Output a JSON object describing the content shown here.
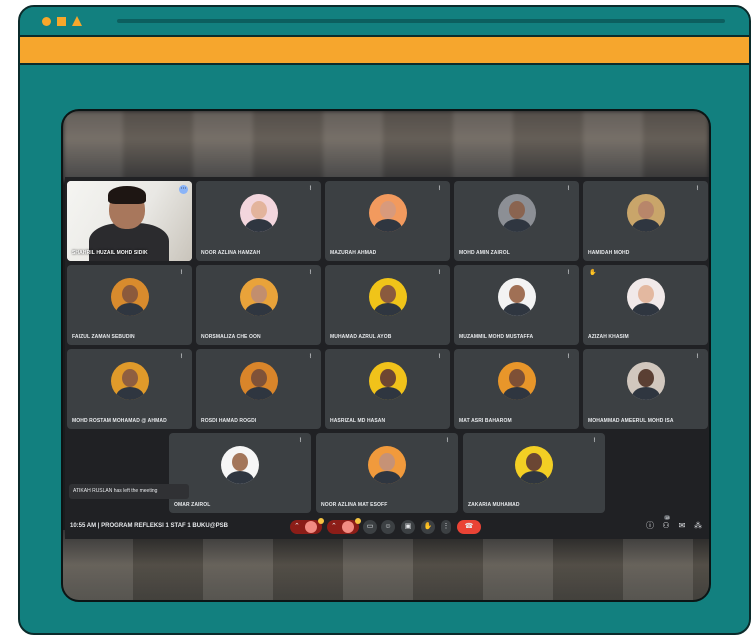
{
  "meeting": {
    "time": "10:55 AM",
    "separator": "|",
    "title": "PROGRAM REFLEKSI 1 STAF 1 BUKU@PSB",
    "toast": "ATIKAH RUSLAN has left the meeting"
  },
  "participants": [
    {
      "name": "SHAHRIL HUZAIL MOHD SIDIK",
      "avatar_color": "#e8e6e0",
      "skin": "#a8775c"
    },
    {
      "name": "NOOR AZLINA HAMZAH",
      "avatar_color": "#f3d6dd",
      "skin": "#e3b49c"
    },
    {
      "name": "MAZURAH AHMAD",
      "avatar_color": "#f29a5e",
      "skin": "#d89a7c"
    },
    {
      "name": "MOHD AMIN ZAIROL",
      "avatar_color": "#8c8f95",
      "skin": "#8a6450"
    },
    {
      "name": "HAMIDAH MOHD",
      "avatar_color": "#c9a56a",
      "skin": "#b8866a"
    },
    {
      "name": "FAIZUL ZAMAN SEBUDIN",
      "avatar_color": "#d88b2d",
      "skin": "#8b5a3c"
    },
    {
      "name": "NORSMALIZA CHE OON",
      "avatar_color": "#e9a33a",
      "skin": "#c28e6e"
    },
    {
      "name": "MUHAMAD AZRUL AYOB",
      "avatar_color": "#f0c419",
      "skin": "#8a5a3e"
    },
    {
      "name": "MUZAMMIL MOHD MUSTAFFA",
      "avatar_color": "#f3f3f3",
      "skin": "#a07055"
    },
    {
      "name": "AZIZAH KHASIM",
      "avatar_color": "#f1e9e9",
      "skin": "#e3b8a0"
    },
    {
      "name": "MOHD ROSTAM MOHAMAD @ AHMAD",
      "avatar_color": "#e09a2a",
      "skin": "#8f5e40"
    },
    {
      "name": "ROSDI HAMAD ROGDI",
      "avatar_color": "#d9852a",
      "skin": "#7f5238"
    },
    {
      "name": "HASRIZAL MD HASAN",
      "avatar_color": "#f1c21a",
      "skin": "#6e4632"
    },
    {
      "name": "MAT ASRI BAHAROM",
      "avatar_color": "#e8962a",
      "skin": "#7e5036"
    },
    {
      "name": "MOHAMMAD AMEERUL MOHD ISA",
      "avatar_color": "#d1c7be",
      "skin": "#5a3f33"
    },
    {
      "name": "OMAR ZAIROL",
      "avatar_color": "#f6f6f6",
      "skin": "#a3765a"
    },
    {
      "name": "NOOR AZLINA MAT ESOFF",
      "avatar_color": "#f19a3c",
      "skin": "#c69276"
    },
    {
      "name": "ZAKARIA MUHAMAD",
      "avatar_color": "#f3cf24",
      "skin": "#6b4634"
    }
  ],
  "controls": {
    "present_icon": "present-icon",
    "more_icon": "more-vert-icon",
    "hangup_icon": "call-end-icon"
  },
  "right_badge": "18"
}
